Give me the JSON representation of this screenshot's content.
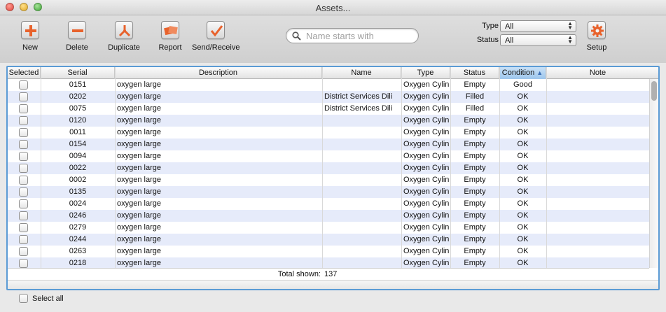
{
  "window": {
    "title": "Assets..."
  },
  "toolbar": {
    "new_label": "New",
    "delete_label": "Delete",
    "duplicate_label": "Duplicate",
    "report_label": "Report",
    "send_receive_label": "Send/Receive",
    "setup_label": "Setup",
    "icons": {
      "new": "plus-icon",
      "delete": "minus-icon",
      "duplicate": "duplicate-icon",
      "report": "report-icon",
      "send_receive": "checkmark-icon",
      "setup": "gear-icon"
    },
    "icon_accent_color": "#e8622c"
  },
  "search": {
    "placeholder": "Name starts with",
    "value": ""
  },
  "filters": {
    "type_label": "Type",
    "type_value": "All",
    "status_label": "Status",
    "status_value": "All"
  },
  "table": {
    "columns": [
      "Selected",
      "Serial",
      "Description",
      "Name",
      "Type",
      "Status",
      "Condition",
      "Note"
    ],
    "sorted_column": "Condition",
    "sort_direction": "ascending",
    "rows": [
      {
        "serial": "0151",
        "description": "oxygen large",
        "name": "",
        "type": "Oxygen Cylin",
        "status": "Empty",
        "condition": "Good",
        "note": ""
      },
      {
        "serial": "0202",
        "description": "oxygen large",
        "name": "District Services Dili",
        "type": "Oxygen Cylin",
        "status": "Filled",
        "condition": "OK",
        "note": ""
      },
      {
        "serial": "0075",
        "description": "oxygen large",
        "name": "District Services Dili",
        "type": "Oxygen Cylin",
        "status": "Filled",
        "condition": "OK",
        "note": ""
      },
      {
        "serial": "0120",
        "description": "oxygen large",
        "name": "",
        "type": "Oxygen Cylin",
        "status": "Empty",
        "condition": "OK",
        "note": ""
      },
      {
        "serial": "0011",
        "description": "oxygen large",
        "name": "",
        "type": "Oxygen Cylin",
        "status": "Empty",
        "condition": "OK",
        "note": ""
      },
      {
        "serial": "0154",
        "description": "oxygen large",
        "name": "",
        "type": "Oxygen Cylin",
        "status": "Empty",
        "condition": "OK",
        "note": ""
      },
      {
        "serial": "0094",
        "description": "oxygen large",
        "name": "",
        "type": "Oxygen Cylin",
        "status": "Empty",
        "condition": "OK",
        "note": ""
      },
      {
        "serial": "0022",
        "description": "oxygen large",
        "name": "",
        "type": "Oxygen Cylin",
        "status": "Empty",
        "condition": "OK",
        "note": ""
      },
      {
        "serial": "0002",
        "description": "oxygen large",
        "name": "",
        "type": "Oxygen Cylin",
        "status": "Empty",
        "condition": "OK",
        "note": ""
      },
      {
        "serial": "0135",
        "description": "oxygen large",
        "name": "",
        "type": "Oxygen Cylin",
        "status": "Empty",
        "condition": "OK",
        "note": ""
      },
      {
        "serial": "0024",
        "description": "oxygen large",
        "name": "",
        "type": "Oxygen Cylin",
        "status": "Empty",
        "condition": "OK",
        "note": ""
      },
      {
        "serial": "0246",
        "description": "oxygen large",
        "name": "",
        "type": "Oxygen Cylin",
        "status": "Empty",
        "condition": "OK",
        "note": ""
      },
      {
        "serial": "0279",
        "description": "oxygen large",
        "name": "",
        "type": "Oxygen Cylin",
        "status": "Empty",
        "condition": "OK",
        "note": ""
      },
      {
        "serial": "0244",
        "description": "oxygen large",
        "name": "",
        "type": "Oxygen Cylin",
        "status": "Empty",
        "condition": "OK",
        "note": ""
      },
      {
        "serial": "0263",
        "description": "oxygen large",
        "name": "",
        "type": "Oxygen Cylin",
        "status": "Empty",
        "condition": "OK",
        "note": ""
      },
      {
        "serial": "0218",
        "description": "oxygen large",
        "name": "",
        "type": "Oxygen Cylin",
        "status": "Empty",
        "condition": "OK",
        "note": ""
      }
    ],
    "total_label": "Total shown:",
    "total_value": "137"
  },
  "select_all": {
    "label": "Select all",
    "checked": false
  },
  "colors": {
    "row_alt": "#e6ebfa",
    "focus_border": "#5b9bd5",
    "sorted_header": "#9dc6ec"
  }
}
